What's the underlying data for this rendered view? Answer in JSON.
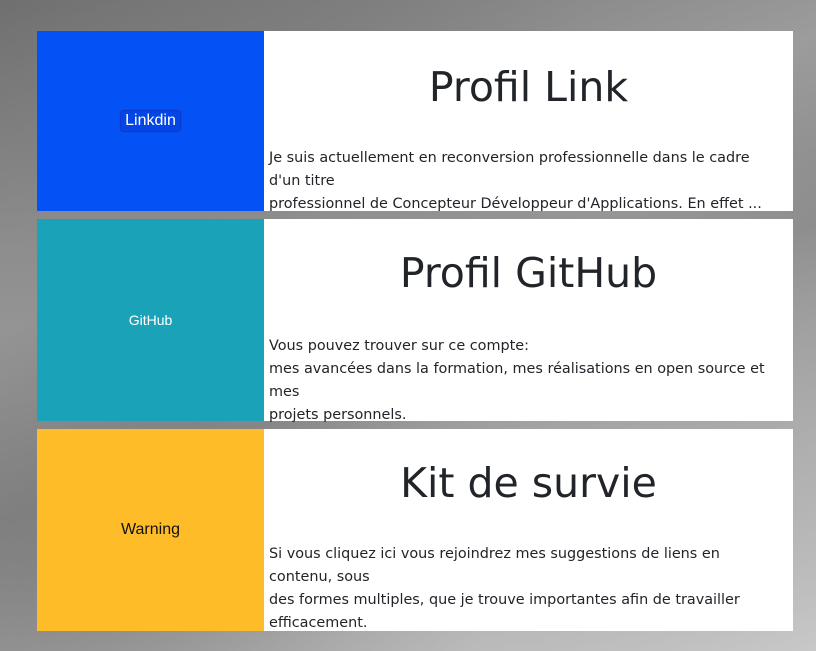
{
  "cards": [
    {
      "button_label": "Linkdin",
      "title": "Profil Link",
      "text": "Je suis actuellement en reconversion professionnelle dans le cadre d'un titre\nprofessionnel de Concepteur Développeur d'Applications. En effet ...",
      "side_color": "#0452f5"
    },
    {
      "button_label": "GitHub",
      "title": "Profil GitHub",
      "text": "Vous pouvez trouver sur ce compte:\nmes avancées dans la formation, mes réalisations en open source et mes\nprojets personnels.",
      "side_color": "#1aa2b8"
    },
    {
      "button_label": "Warning",
      "title": "Kit de survie",
      "text": "Si vous cliquez ici vous rejoindrez mes suggestions de liens en contenu, sous\ndes formes multiples, que je trouve importantes afin de travailler\nefficacement.",
      "side_color": "#ffbc29"
    }
  ]
}
